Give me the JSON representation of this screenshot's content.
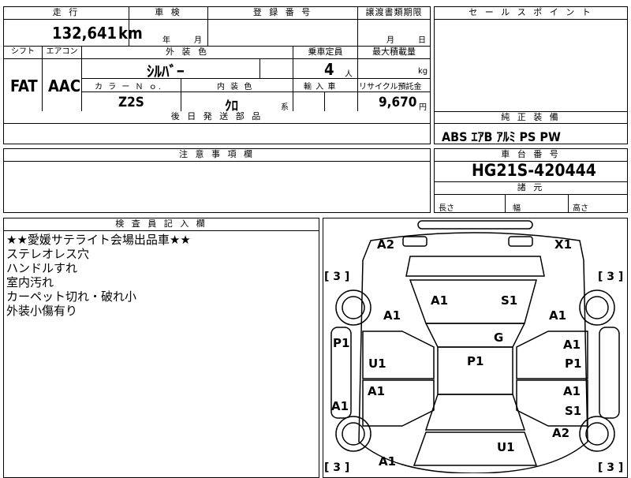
{
  "sheet": {
    "header": {
      "mileage_label": "走 行",
      "inspection_label": "車 検",
      "registration_label": "登 録 番 号",
      "transfer_deadline_label": "譲渡書類期限",
      "sales_point_label": "セ ー ル ス ポ イ ン ト"
    },
    "mileage": {
      "value": "132,641",
      "unit": "km"
    },
    "inspection": {
      "year_unit": "年",
      "month_unit": "月"
    },
    "transfer": {
      "month_unit": "月",
      "day_unit": "日"
    },
    "specs": {
      "shift_label": "シフト",
      "ac_label": "エアコン",
      "exterior_color_label": "外 装 色",
      "capacity_label": "乗車定員",
      "max_load_label": "最大積載量",
      "shift_value": "FAT",
      "ac_value": "AAC",
      "exterior_color_value": "ｼﾙﾊﾞｰ",
      "capacity_value": "4",
      "capacity_unit": "人",
      "max_load_unit": "kg",
      "color_no_label": "カ ラ ー Ｎ ｏ.",
      "interior_color_label": "内 装 色",
      "import_label": "輸 入 車",
      "recycle_label": "リサイクル預託金",
      "color_no_value": "Z2S",
      "interior_color_value": "ｸﾛ",
      "interior_suffix": "系",
      "recycle_value": "9,670",
      "recycle_unit": "円",
      "later_parts_label": "後 日 発 送 部 品"
    },
    "equipment": {
      "label": "純 正 装 備",
      "value": "ABS ｴｱB ｱﾙﾐ PS PW"
    },
    "caution": {
      "label": "注 意 事 項 欄"
    },
    "chassis": {
      "label": "車 台 番 号",
      "value": "HG21S-420444",
      "dimensions_label": "諸 元",
      "length_label": "長さ",
      "width_label": "幅",
      "height_label": "高さ"
    },
    "inspector": {
      "label": "検 査 員 記 入 欄",
      "notes": [
        "★★愛媛サテライト会場出品車★★",
        "ステレオレス穴",
        "ハンドルすれ",
        "室内汚れ",
        "カーペット切れ・破れ小",
        "外装小傷有り"
      ]
    },
    "diagram": {
      "marks": {
        "front_bumper_left": "A2",
        "front_bumper_right": "X1",
        "tire_fl": "[ 3 ]",
        "tire_fr": "[ 3 ]",
        "tire_rl": "[ 3 ]",
        "tire_rr": "[ 3 ]",
        "hood_left": "A1",
        "hood_right": "S1",
        "fender_left": "A1",
        "fender_right": "A1",
        "pillar_left": "P1",
        "door_front_left": "U1",
        "windshield": "G",
        "roof": "P1",
        "door_front_right_top": "A1",
        "door_front_right_bottom": "P1",
        "door_rear_left": "A1",
        "rocker_left": "A1",
        "door_rear_right_top": "A1",
        "door_rear_right_bottom": "S1",
        "quarter_right": "A2",
        "trunk": "U1",
        "quarter_left": "A1"
      }
    }
  }
}
